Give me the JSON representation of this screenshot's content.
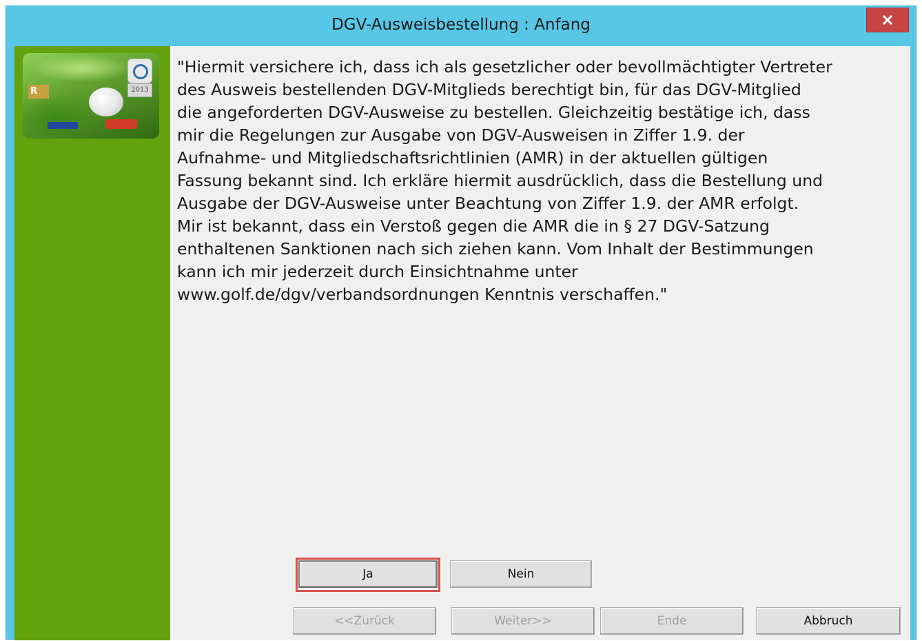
{
  "window": {
    "title": "DGV-Ausweisbestellung  : Anfang",
    "close_label": "x"
  },
  "sidebar": {
    "logo_icon": "golf-sponsor-logo-icon",
    "logo_year": "2013",
    "logo_r_mark": "R"
  },
  "message": {
    "text": "\"Hiermit versichere ich, dass ich als gesetzlicher oder bevollmächtigter Vertreter\ndes Ausweis bestellenden DGV-Mitglieds berechtigt bin, für das DGV-Mitglied\ndie angeforderten DGV-Ausweise zu bestellen. Gleichzeitig bestätige ich, dass\nmir die Regelungen zur Ausgabe von DGV-Ausweisen in Ziffer 1.9. der\nAufnahme- und Mitgliedschaftsrichtlinien (AMR) in der aktuellen gültigen\nFassung bekannt sind. Ich erkläre hiermit ausdrücklich, dass die Bestellung und\nAusgabe der DGV-Ausweise unter Beachtung von Ziffer 1.9. der AMR erfolgt.\nMir ist bekannt, dass ein Verstoß gegen die AMR die in § 27 DGV-Satzung\nenthaltenen Sanktionen nach sich ziehen kann. Vom Inhalt der Bestimmungen\nkann ich mir jederzeit durch Einsichtnahme unter\nwww.golf.de/dgv/verbandsordnungen Kenntnis verschaffen.\""
  },
  "buttons": {
    "ja": "Ja",
    "nein": "Nein",
    "zurueck": "<<Zurück",
    "weiter": "Weiter>>",
    "ende": "Ende",
    "abbruch": "Abbruch"
  },
  "colors": {
    "titlebar": "#58c7e6",
    "sidebar": "#63a20c",
    "close_button": "#c74645",
    "highlight": "#d9534f"
  }
}
